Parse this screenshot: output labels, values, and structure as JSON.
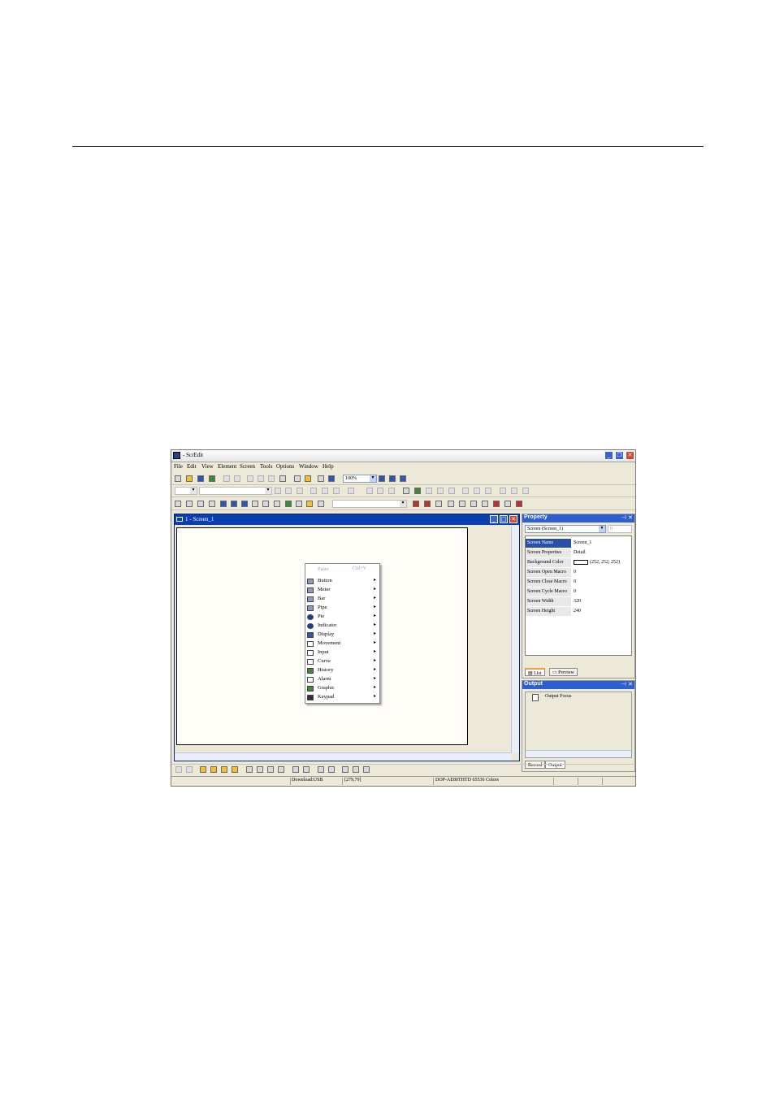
{
  "app": {
    "title": "- ScrEdit"
  },
  "menu": [
    "File",
    "Edit",
    "View",
    "Element",
    "Screen",
    "Tools",
    "Options",
    "Window",
    "Help"
  ],
  "toolbar": {
    "zoom": "100%"
  },
  "screen_window": {
    "title": "1 - Screen_1"
  },
  "context_menu": {
    "paste_label": "Paste",
    "paste_shortcut": "Ctrl+V",
    "items": [
      "Button",
      "Meter",
      "Bar",
      "Pipe",
      "Pie",
      "Indicator",
      "Display",
      "Movement",
      "Input",
      "Curve",
      "History",
      "Alarm",
      "Graphic",
      "Keypad"
    ]
  },
  "property": {
    "title": "Property",
    "selector": "Screen (Screen_1)",
    "selector_index": "0",
    "rows": [
      {
        "key": "Screen Name",
        "value": "Screen_1"
      },
      {
        "key": "Screen Properties",
        "value": "Detail"
      },
      {
        "key": "Background Color",
        "value": "(252, 252, 252)"
      },
      {
        "key": "Screen Open Macro",
        "value": "0"
      },
      {
        "key": "Screen Close Macro",
        "value": "0"
      },
      {
        "key": "Screen Cycle Macro",
        "value": "0"
      },
      {
        "key": "Screen Width",
        "value": "320"
      },
      {
        "key": "Screen Height",
        "value": "240"
      }
    ],
    "tabs": [
      "List",
      "Preview"
    ]
  },
  "output": {
    "title": "Output",
    "item": "Output Focus",
    "tabs": [
      "Record",
      "Output"
    ]
  },
  "status": {
    "download": "Download:USB",
    "coords": "[279,79]",
    "model": "DOP-AE80THTD 65536 Colors"
  }
}
